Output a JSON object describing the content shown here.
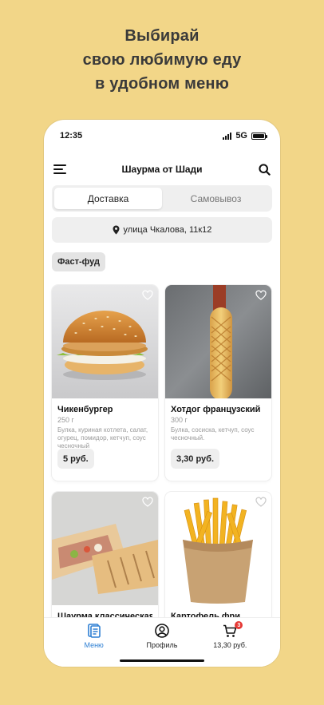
{
  "promo": {
    "line1": "Выбирай",
    "line2": "свою любимую еду",
    "line3": "в удобном меню"
  },
  "status": {
    "time": "12:35",
    "network": "5G"
  },
  "header": {
    "title": "Шаурма от Шади",
    "menu_icon": "hamburger-menu-icon",
    "search_icon": "search-icon"
  },
  "delivery_toggle": {
    "options": [
      "Доставка",
      "Самовывоз"
    ],
    "selected": "Доставка"
  },
  "address": {
    "text": "улица Чкалова, 11к12",
    "icon": "location-pin-icon"
  },
  "category": {
    "label": "Фаст-фуд"
  },
  "products": [
    {
      "name": "Чикенбургер",
      "weight": "250 г",
      "description": "Булка, куриная котлета, салат, огурец, помидор, кетчуп, соус чесночный",
      "price": "5 руб.",
      "image": "burger"
    },
    {
      "name": "Хотдог французский",
      "weight": "300 г",
      "description": "Булка, сосиска, кетчуп, соус чесночный.",
      "price": "3,30 руб.",
      "image": "hotdog"
    },
    {
      "name": "Шаурма классическая",
      "weight": "",
      "description": "",
      "price": "",
      "image": "shawarma"
    },
    {
      "name": "Картофель фри",
      "weight": "",
      "description": "",
      "price": "",
      "image": "fries"
    }
  ],
  "tabbar": {
    "menu": "Меню",
    "profile": "Профиль",
    "cart": "13,30 руб.",
    "cart_badge": "3"
  },
  "colors": {
    "background": "#f2d688",
    "accent": "#2d7fd3",
    "badge": "#e53935"
  }
}
